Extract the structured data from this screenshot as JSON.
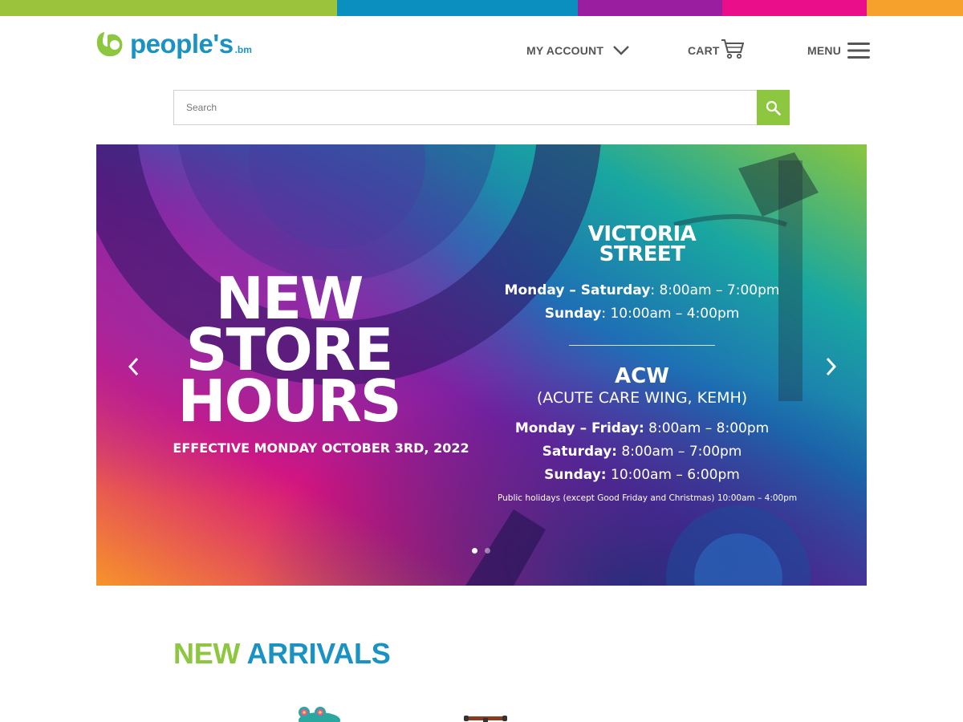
{
  "colors": {
    "stripe": [
      "#9cc33c",
      "#0a8fbf",
      "#9a1fa0",
      "#ea0e8a",
      "#f6a12b"
    ],
    "brand_green": "#8dc63f",
    "brand_blue": "#1a93c4",
    "search_button": "#8dc63f",
    "nav_text": "#555555"
  },
  "header": {
    "logo_text": "people's",
    "logo_tld": ".bm",
    "my_account_label": "MY ACCOUNT",
    "cart_label": "CART",
    "menu_label": "MENU",
    "icons": {
      "account": "chevron-down-icon",
      "cart": "cart-icon",
      "menu": "hamburger-icon"
    }
  },
  "search": {
    "placeholder": "Search",
    "value": "",
    "icon": "search-icon"
  },
  "hero": {
    "headline_line1": "NEW",
    "headline_line2": "STORE",
    "headline_line3": "HOURS",
    "effective": "EFFECTIVE MONDAY OCTOBER 3RD, 2022",
    "victoria": {
      "title_line1": "VICTORIA",
      "title_line2": "STREET",
      "row1_day": "Monday – Saturday",
      "row1_time": ": 8:00am – 7:00pm",
      "row2_day": "Sunday",
      "row2_time": ": 10:00am – 4:00pm"
    },
    "acw": {
      "title": "ACW",
      "subtitle": "(ACUTE CARE WING, KEMH)",
      "row1_day": "Monday – Friday:",
      "row1_time": " 8:00am – 8:00pm",
      "row2_day": "Saturday:",
      "row2_time": " 8:00am – 7:00pm",
      "row3_day": "Sunday:",
      "row3_time": " 10:00am – 6:00pm"
    },
    "holiday_note": "Public holidays (except Good Friday and Christmas) 10:00am – 4:00pm",
    "prev_icon": "chevron-left-icon",
    "next_icon": "chevron-right-icon",
    "slide_count": 2,
    "active_slide": 1
  },
  "arrivals": {
    "title_word1": "NEW",
    "title_word2": "ARRIVALS"
  }
}
